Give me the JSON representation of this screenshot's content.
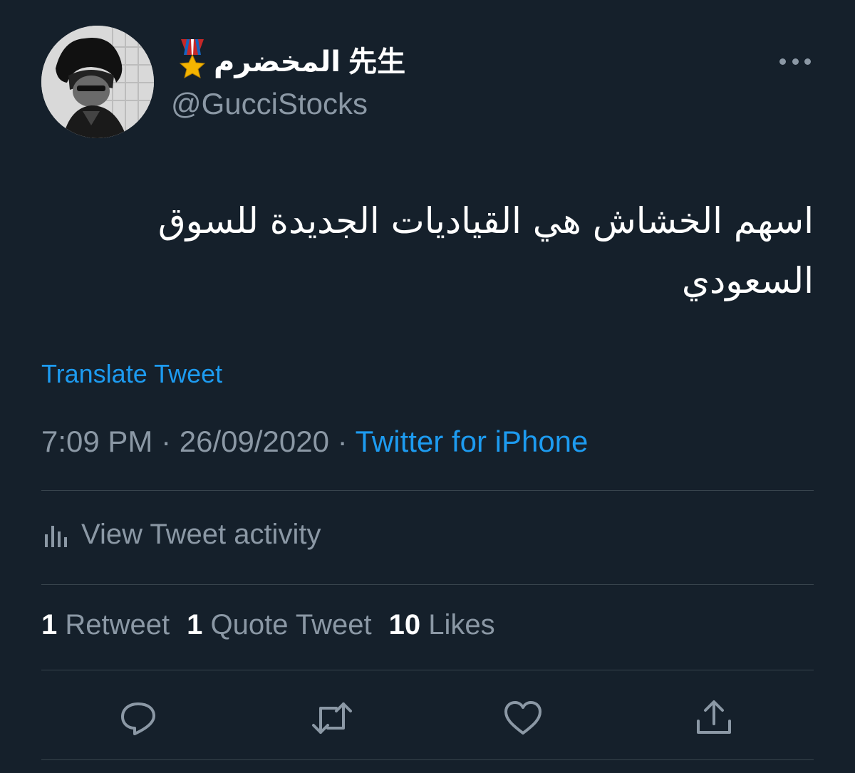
{
  "tweet": {
    "display_name": "المخضرم 先生",
    "handle": "@GucciStocks",
    "text_line1": "اسهم الخشاش هي القياديات الجديدة للسوق",
    "text_line2": "السعودي",
    "translate_label": "Translate Tweet",
    "time": "7:09 PM",
    "separator": "·",
    "date": "26/09/2020",
    "source": "Twitter for iPhone",
    "activity_label": "View Tweet activity"
  },
  "stats": {
    "retweet_count": "1",
    "retweet_label": "Retweet",
    "quote_count": "1",
    "quote_label": "Quote Tweet",
    "likes_count": "10",
    "likes_label": "Likes"
  },
  "icons": {
    "medal": "military-medal-icon",
    "more": "more-horizontal-icon",
    "activity": "bar-chart-icon",
    "reply": "reply-icon",
    "retweet": "retweet-icon",
    "like": "heart-icon",
    "share": "share-icon"
  },
  "colors": {
    "background": "#15202b",
    "primary_text": "#ffffff",
    "secondary_text": "#8b98a5",
    "accent": "#1d9bf0",
    "divider": "#38444d"
  }
}
